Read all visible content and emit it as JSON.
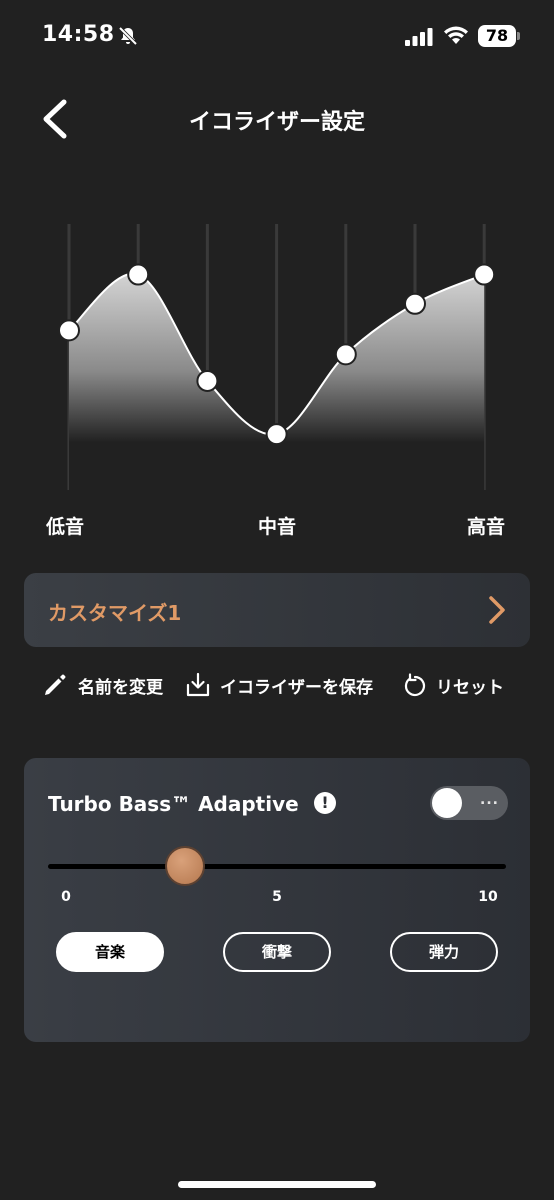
{
  "status_bar": {
    "time": "14:58",
    "battery": "78"
  },
  "header": {
    "title": "イコライザー設定"
  },
  "eq": {
    "bands": [
      60,
      81,
      41,
      21,
      51,
      70,
      81
    ],
    "labels": {
      "low": "低音",
      "mid": "中音",
      "high": "高音"
    }
  },
  "preset": {
    "name": "カスタマイズ1"
  },
  "actions": {
    "rename": "名前を変更",
    "save": "イコライザーを保存",
    "reset": "リセット"
  },
  "turbo": {
    "title": "Turbo Bass™ Adaptive",
    "info": "!",
    "toggle_dots": "...",
    "toggle_on": false,
    "level": 3,
    "min": 0,
    "max": 10,
    "ticks": [
      "0",
      "5",
      "10"
    ],
    "modes": [
      "音楽",
      "衝撃",
      "弾力"
    ],
    "active_mode": 0
  },
  "colors": {
    "accent": "#e09a66",
    "background": "#212121",
    "card": "#34373c"
  }
}
